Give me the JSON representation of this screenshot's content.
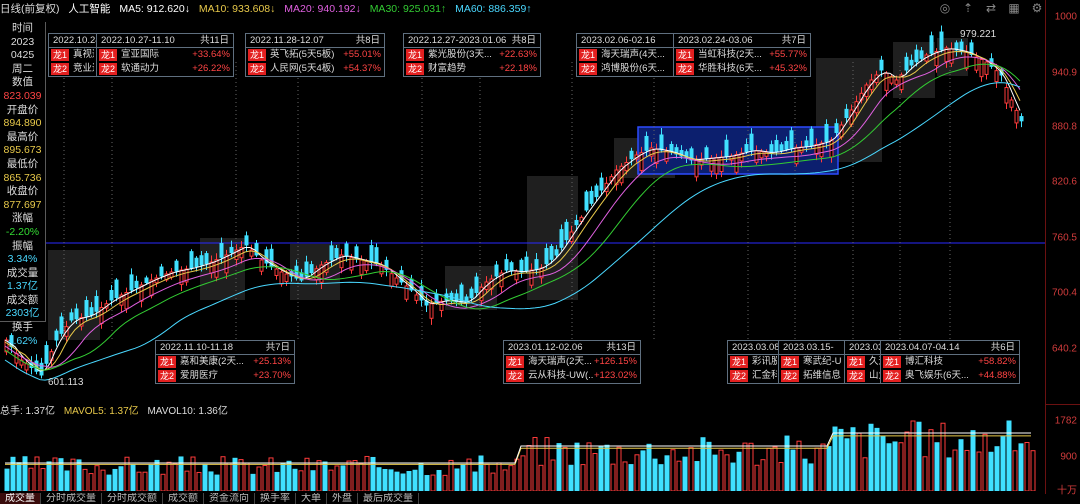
{
  "header": {
    "period": "日线(前复权)",
    "name": "人工智能",
    "ma5": "MA5: 912.620↓",
    "ma10": "MA10: 933.608↓",
    "ma20": "MA20: 940.192↓",
    "ma30": "MA30: 925.031↑",
    "ma60": "MA60: 886.359↑",
    "colors": {
      "ma5": "#ffffff",
      "ma10": "#e8c94a",
      "ma20": "#e060e0",
      "ma30": "#33cc33",
      "ma60": "#4ad8ff"
    }
  },
  "info_panel": {
    "time_label": "时间",
    "year": "2023",
    "date": "0425",
    "weekday": "周二",
    "value_label": "数值",
    "value": "823.039",
    "open_label": "开盘价",
    "open": "894.890",
    "high_label": "最高价",
    "high": "895.673",
    "low_label": "最低价",
    "low": "865.736",
    "close_label": "收盘价",
    "close": "877.697",
    "change_label": "涨幅",
    "change": "-2.20%",
    "amplitude_label": "振幅",
    "amplitude": "3.34%",
    "volume_label": "成交量",
    "volume": "1.37亿",
    "amount_label": "成交额",
    "amount": "2303亿",
    "turnover_label": "换手",
    "turnover": "4.62%"
  },
  "price_axis": [
    "1000",
    "940.9",
    "880.8",
    "820.6",
    "760.5",
    "700.4",
    "640.2"
  ],
  "annotations": [
    {
      "range": "2022.10.24",
      "count": "",
      "rows": [
        {
          "tag": "龙1",
          "name": "真视通",
          "pct": ""
        },
        {
          "tag": "龙2",
          "name": "竞业达",
          "pct": ""
        }
      ]
    },
    {
      "range": "2022.10.27-11.10",
      "count": "共11日",
      "rows": [
        {
          "tag": "龙1",
          "name": "宣亚国际",
          "pct": "+33.64%"
        },
        {
          "tag": "龙2",
          "name": "软通动力",
          "pct": "+26.22%"
        }
      ]
    },
    {
      "range": "2022.11.28-12.07",
      "count": "共8日",
      "rows": [
        {
          "tag": "龙1",
          "name": "英飞拓(5天5板)",
          "pct": "+55.01%"
        },
        {
          "tag": "龙2",
          "name": "人民网(5天4板)",
          "pct": "+54.37%"
        }
      ]
    },
    {
      "range": "2022.12.27-2023.01.06",
      "count": "共8日",
      "rows": [
        {
          "tag": "龙1",
          "name": "紫光股份(3天...",
          "pct": "+22.63%"
        },
        {
          "tag": "龙2",
          "name": "财富趋势",
          "pct": "+22.18%"
        }
      ]
    },
    {
      "range": "2023.02.06-02.16",
      "count": "",
      "rows": [
        {
          "tag": "龙1",
          "name": "海天瑞声(4天...",
          "pct": ""
        },
        {
          "tag": "龙2",
          "name": "鸿博股份(6天...",
          "pct": ""
        }
      ]
    },
    {
      "range": "2023.02.24-03.06",
      "count": "共7日",
      "rows": [
        {
          "tag": "龙1",
          "name": "当虹科技(2天...",
          "pct": "+55.77%"
        },
        {
          "tag": "龙2",
          "name": "华胜科技(6天...",
          "pct": "+45.32%"
        }
      ]
    },
    {
      "range": "2022.11.10-11.18",
      "count": "共7日",
      "rows": [
        {
          "tag": "龙1",
          "name": "嘉和美康(2天...",
          "pct": "+25.13%"
        },
        {
          "tag": "龙2",
          "name": "爱朋医疗",
          "pct": "+23.70%"
        }
      ]
    },
    {
      "range": "2023.01.12-02.06",
      "count": "共13日",
      "rows": [
        {
          "tag": "龙1",
          "name": "海天瑞声(2天...",
          "pct": "+126.15%"
        },
        {
          "tag": "龙2",
          "name": "云从科技-UW(...",
          "pct": "+123.02%"
        }
      ]
    },
    {
      "range": "2023.03.08-",
      "count": "",
      "rows": [
        {
          "tag": "龙1",
          "name": "彩讯股份",
          "pct": ""
        },
        {
          "tag": "龙2",
          "name": "汇金科技",
          "pct": ""
        }
      ]
    },
    {
      "range": "2023.03.15-03",
      "count": "",
      "rows": [
        {
          "tag": "龙1",
          "name": "寒武纪-U",
          "pct": ""
        },
        {
          "tag": "龙2",
          "name": "拓维信息",
          "pct": ""
        }
      ]
    },
    {
      "range": "2023.03.",
      "count": "",
      "rows": [
        {
          "tag": "龙1",
          "name": "久远",
          "pct": ""
        },
        {
          "tag": "龙2",
          "name": "山大",
          "pct": ""
        }
      ]
    },
    {
      "range": "2023.04.07-04.14",
      "count": "共6日",
      "rows": [
        {
          "tag": "龙1",
          "name": "博汇科技",
          "pct": "+58.82%"
        },
        {
          "tag": "龙2",
          "name": "奥飞娱乐(6天...",
          "pct": "+44.88%"
        }
      ]
    }
  ],
  "peak_label": "979.221",
  "low_label": "601.113",
  "volume_header": {
    "total": "总手: 1.37亿",
    "mavol5": "MAVOL5: 1.37亿",
    "mavol10": "MAVOL10: 1.36亿"
  },
  "volume_axis": [
    "1782",
    "900",
    "十万"
  ],
  "tabs": [
    "成交量",
    "分时成交量",
    "分时成交额",
    "成交额",
    "资金流向",
    "换手率",
    "大单",
    "外盘",
    "最后成交量"
  ],
  "icons": [
    "ring-icon",
    "rise-icon",
    "exchange-icon",
    "grid-icon",
    "settings-icon"
  ],
  "chart_data": {
    "type": "candlestick",
    "ylim": [
      601.113,
      1000
    ],
    "highest_marked": 979.221,
    "lowest_marked": 601.113,
    "last_bar": {
      "open": 894.89,
      "high": 895.673,
      "low": 865.736,
      "close": 877.697
    }
  }
}
